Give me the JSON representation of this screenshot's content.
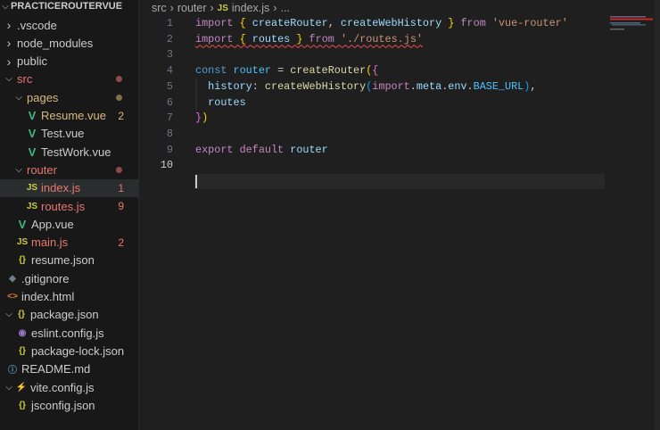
{
  "explorer": {
    "root": "PRACTICEROUTERVUE",
    "items": [
      {
        "label": ".vscode",
        "kind": "folder",
        "open": false,
        "depth": 0,
        "color": "#cccccc"
      },
      {
        "label": "node_modules",
        "kind": "folder",
        "open": false,
        "depth": 0,
        "color": "#cccccc"
      },
      {
        "label": "public",
        "kind": "folder",
        "open": false,
        "depth": 0,
        "color": "#cccccc"
      },
      {
        "label": "src",
        "kind": "folder",
        "open": true,
        "depth": 0,
        "color": "#e8776f",
        "dot": "#8c4a4a"
      },
      {
        "label": "pages",
        "kind": "folder",
        "open": true,
        "depth": 1,
        "color": "#d7ba7d",
        "dot": "#7f7047"
      },
      {
        "label": "Resume.vue",
        "kind": "vue",
        "depth": 2,
        "color": "#d7ba7d",
        "badge": "2"
      },
      {
        "label": "Test.vue",
        "kind": "vue",
        "depth": 2,
        "color": "#cccccc"
      },
      {
        "label": "TestWork.vue",
        "kind": "vue",
        "depth": 2,
        "color": "#cccccc"
      },
      {
        "label": "router",
        "kind": "folder",
        "open": true,
        "depth": 1,
        "color": "#e8776f",
        "dot": "#8c4a4a"
      },
      {
        "label": "index.js",
        "kind": "js",
        "depth": 2,
        "color": "#e8776f",
        "badge": "1",
        "selected": true
      },
      {
        "label": "routes.js",
        "kind": "js",
        "depth": 2,
        "color": "#e8776f",
        "badge": "9"
      },
      {
        "label": "App.vue",
        "kind": "vue",
        "depth": 1,
        "color": "#cccccc"
      },
      {
        "label": "main.js",
        "kind": "js",
        "depth": 1,
        "color": "#e8776f",
        "badge": "2"
      },
      {
        "label": "resume.json",
        "kind": "json",
        "depth": 1,
        "color": "#cccccc"
      },
      {
        "label": ".gitignore",
        "kind": "git",
        "depth": 0,
        "color": "#cccccc"
      },
      {
        "label": "index.html",
        "kind": "html",
        "depth": 0,
        "color": "#cccccc"
      },
      {
        "label": "package.json",
        "kind": "json",
        "open": true,
        "depth": 0,
        "color": "#cccccc",
        "chev": true
      },
      {
        "label": "eslint.config.js",
        "kind": "eslint",
        "depth": 1,
        "color": "#cccccc"
      },
      {
        "label": "package-lock.json",
        "kind": "json",
        "depth": 1,
        "color": "#cccccc"
      },
      {
        "label": "README.md",
        "kind": "info",
        "depth": 0,
        "color": "#cccccc"
      },
      {
        "label": "vite.config.js",
        "kind": "vite",
        "open": true,
        "depth": 0,
        "color": "#cccccc",
        "chev": true
      },
      {
        "label": "jsconfig.json",
        "kind": "json",
        "depth": 1,
        "color": "#cccccc"
      }
    ]
  },
  "breadcrumb": {
    "parts": [
      "src",
      "router",
      "index.js",
      "..."
    ],
    "js_icon": "JS"
  },
  "editor": {
    "line_numbers": [
      "1",
      "2",
      "3",
      "4",
      "5",
      "6",
      "7",
      "8",
      "9",
      "10"
    ],
    "current_line": 10
  },
  "icons": {
    "vue": "V",
    "js": "JS",
    "json": "{}",
    "git": "◆",
    "html": "<>",
    "eslint": "◉",
    "info": "ⓘ",
    "vite": "⚡"
  }
}
